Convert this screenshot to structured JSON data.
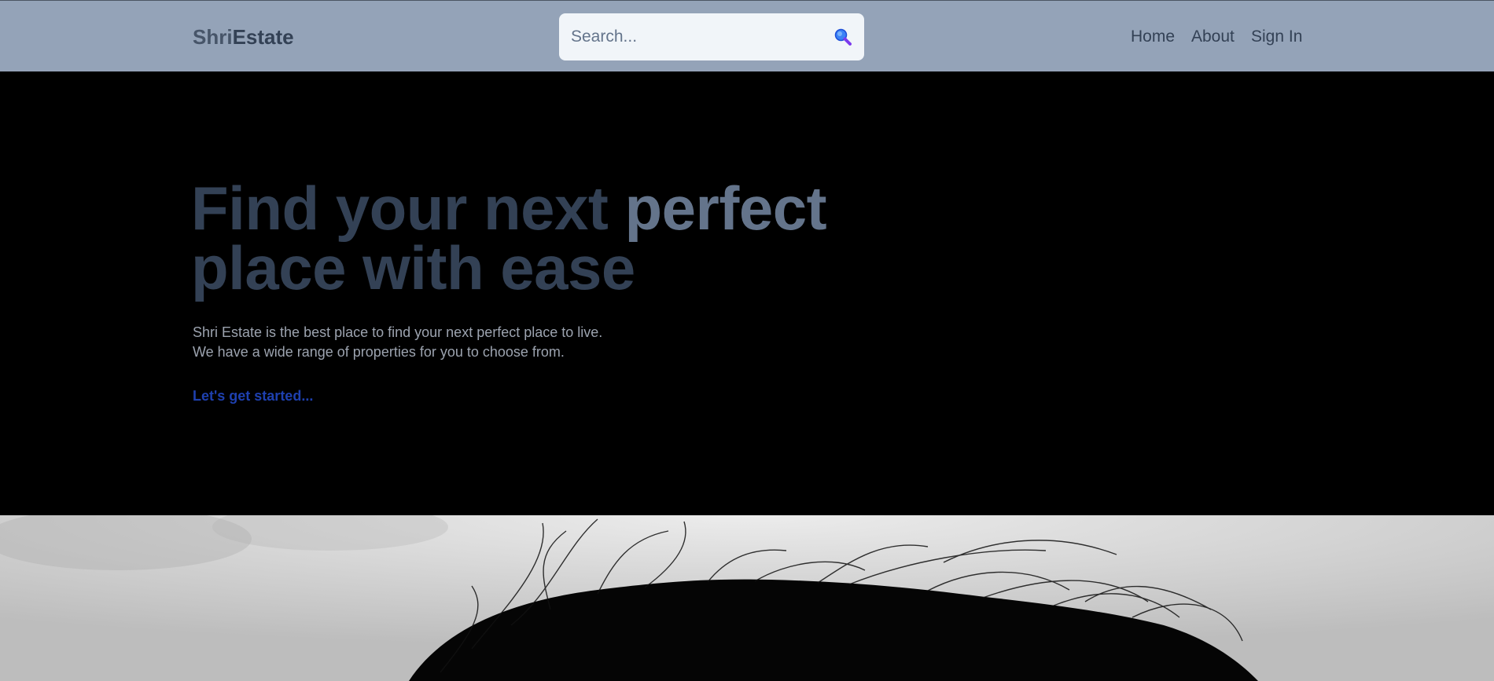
{
  "header": {
    "logo_part1": "Shri",
    "logo_part2": "Estate",
    "search_placeholder": "Search...",
    "search_icon": "magnifying-glass-icon",
    "nav": {
      "home": "Home",
      "about": "About",
      "sign_in": "Sign In"
    }
  },
  "hero": {
    "title_part1": "Find your next ",
    "title_accent": "perfect",
    "title_line2": "place with ease",
    "desc_line1": "Shri Estate is the best place to find your next perfect place to live.",
    "desc_line2": "We have a wide range of properties for you to choose from.",
    "cta": "Let's get started..."
  },
  "colors": {
    "header_bg": "#94a3b8",
    "hero_bg": "#000000",
    "title": "#334155",
    "title_accent": "#64748b",
    "cta": "#1e40af"
  }
}
